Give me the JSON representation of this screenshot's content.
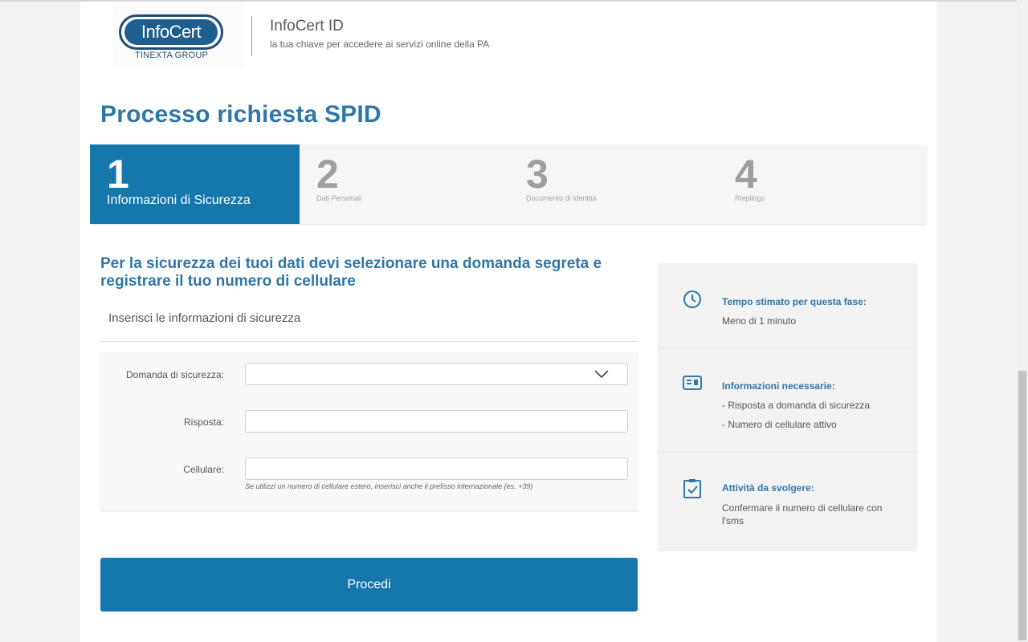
{
  "header": {
    "logo_text": "InfoCert",
    "logo_tagline": "TINEXTA GROUP",
    "title": "InfoCert ID",
    "subtitle": "la tua chiave per accedere ai servizi online della PA"
  },
  "page_title": "Processo richiesta SPID",
  "steps": [
    {
      "number": "1",
      "label": "Informazioni di Sicurezza",
      "active": true
    },
    {
      "number": "2",
      "label": "Dati Personali",
      "active": false
    },
    {
      "number": "3",
      "label": "Documento di Identità",
      "active": false
    },
    {
      "number": "4",
      "label": "Riepilogo",
      "active": false
    }
  ],
  "section_title": "Per la sicurezza dei tuoi dati devi selezionare una domanda segreta e registrare il tuo numero di cellulare",
  "form_subtitle": "Inserisci le informazioni di sicurezza",
  "form": {
    "question_label": "Domanda di sicurezza:",
    "question_value": "",
    "answer_label": "Risposta:",
    "answer_value": "",
    "phone_label": "Cellulare:",
    "phone_value": "",
    "phone_help": "Se utilizzi un numero di cellulare estero, inserisci anche il prefisso internazionale (es. +39)"
  },
  "proceed_label": "Procedi",
  "info": [
    {
      "icon": "clock-icon",
      "title": "Tempo stimato per questa fase:",
      "lines": [
        "Meno di 1 minuto"
      ]
    },
    {
      "icon": "id-card-icon",
      "title": "Informazioni necessarie:",
      "lines": [
        "- Risposta a domanda di sicurezza",
        "- Numero di cellulare attivo"
      ]
    },
    {
      "icon": "clipboard-check-icon",
      "title": "Attività da svolgere:",
      "lines": [
        "Confermare il numero di cellulare con l'sms"
      ]
    }
  ],
  "colors": {
    "accent": "#1677ac",
    "title_blue": "#2e77aa",
    "background": "#f3f3f3"
  }
}
